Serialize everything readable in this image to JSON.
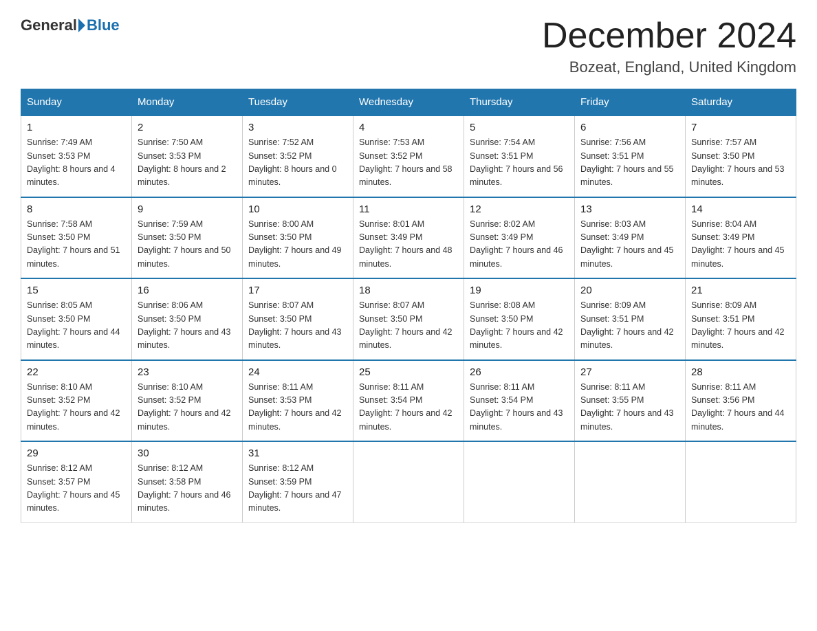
{
  "header": {
    "logo_general": "General",
    "logo_blue": "Blue",
    "month_title": "December 2024",
    "location": "Bozeat, England, United Kingdom"
  },
  "days_of_week": [
    "Sunday",
    "Monday",
    "Tuesday",
    "Wednesday",
    "Thursday",
    "Friday",
    "Saturday"
  ],
  "weeks": [
    [
      {
        "day": "1",
        "sunrise": "7:49 AM",
        "sunset": "3:53 PM",
        "daylight": "8 hours and 4 minutes."
      },
      {
        "day": "2",
        "sunrise": "7:50 AM",
        "sunset": "3:53 PM",
        "daylight": "8 hours and 2 minutes."
      },
      {
        "day": "3",
        "sunrise": "7:52 AM",
        "sunset": "3:52 PM",
        "daylight": "8 hours and 0 minutes."
      },
      {
        "day": "4",
        "sunrise": "7:53 AM",
        "sunset": "3:52 PM",
        "daylight": "7 hours and 58 minutes."
      },
      {
        "day": "5",
        "sunrise": "7:54 AM",
        "sunset": "3:51 PM",
        "daylight": "7 hours and 56 minutes."
      },
      {
        "day": "6",
        "sunrise": "7:56 AM",
        "sunset": "3:51 PM",
        "daylight": "7 hours and 55 minutes."
      },
      {
        "day": "7",
        "sunrise": "7:57 AM",
        "sunset": "3:50 PM",
        "daylight": "7 hours and 53 minutes."
      }
    ],
    [
      {
        "day": "8",
        "sunrise": "7:58 AM",
        "sunset": "3:50 PM",
        "daylight": "7 hours and 51 minutes."
      },
      {
        "day": "9",
        "sunrise": "7:59 AM",
        "sunset": "3:50 PM",
        "daylight": "7 hours and 50 minutes."
      },
      {
        "day": "10",
        "sunrise": "8:00 AM",
        "sunset": "3:50 PM",
        "daylight": "7 hours and 49 minutes."
      },
      {
        "day": "11",
        "sunrise": "8:01 AM",
        "sunset": "3:49 PM",
        "daylight": "7 hours and 48 minutes."
      },
      {
        "day": "12",
        "sunrise": "8:02 AM",
        "sunset": "3:49 PM",
        "daylight": "7 hours and 46 minutes."
      },
      {
        "day": "13",
        "sunrise": "8:03 AM",
        "sunset": "3:49 PM",
        "daylight": "7 hours and 45 minutes."
      },
      {
        "day": "14",
        "sunrise": "8:04 AM",
        "sunset": "3:49 PM",
        "daylight": "7 hours and 45 minutes."
      }
    ],
    [
      {
        "day": "15",
        "sunrise": "8:05 AM",
        "sunset": "3:50 PM",
        "daylight": "7 hours and 44 minutes."
      },
      {
        "day": "16",
        "sunrise": "8:06 AM",
        "sunset": "3:50 PM",
        "daylight": "7 hours and 43 minutes."
      },
      {
        "day": "17",
        "sunrise": "8:07 AM",
        "sunset": "3:50 PM",
        "daylight": "7 hours and 43 minutes."
      },
      {
        "day": "18",
        "sunrise": "8:07 AM",
        "sunset": "3:50 PM",
        "daylight": "7 hours and 42 minutes."
      },
      {
        "day": "19",
        "sunrise": "8:08 AM",
        "sunset": "3:50 PM",
        "daylight": "7 hours and 42 minutes."
      },
      {
        "day": "20",
        "sunrise": "8:09 AM",
        "sunset": "3:51 PM",
        "daylight": "7 hours and 42 minutes."
      },
      {
        "day": "21",
        "sunrise": "8:09 AM",
        "sunset": "3:51 PM",
        "daylight": "7 hours and 42 minutes."
      }
    ],
    [
      {
        "day": "22",
        "sunrise": "8:10 AM",
        "sunset": "3:52 PM",
        "daylight": "7 hours and 42 minutes."
      },
      {
        "day": "23",
        "sunrise": "8:10 AM",
        "sunset": "3:52 PM",
        "daylight": "7 hours and 42 minutes."
      },
      {
        "day": "24",
        "sunrise": "8:11 AM",
        "sunset": "3:53 PM",
        "daylight": "7 hours and 42 minutes."
      },
      {
        "day": "25",
        "sunrise": "8:11 AM",
        "sunset": "3:54 PM",
        "daylight": "7 hours and 42 minutes."
      },
      {
        "day": "26",
        "sunrise": "8:11 AM",
        "sunset": "3:54 PM",
        "daylight": "7 hours and 43 minutes."
      },
      {
        "day": "27",
        "sunrise": "8:11 AM",
        "sunset": "3:55 PM",
        "daylight": "7 hours and 43 minutes."
      },
      {
        "day": "28",
        "sunrise": "8:11 AM",
        "sunset": "3:56 PM",
        "daylight": "7 hours and 44 minutes."
      }
    ],
    [
      {
        "day": "29",
        "sunrise": "8:12 AM",
        "sunset": "3:57 PM",
        "daylight": "7 hours and 45 minutes."
      },
      {
        "day": "30",
        "sunrise": "8:12 AM",
        "sunset": "3:58 PM",
        "daylight": "7 hours and 46 minutes."
      },
      {
        "day": "31",
        "sunrise": "8:12 AM",
        "sunset": "3:59 PM",
        "daylight": "7 hours and 47 minutes."
      },
      null,
      null,
      null,
      null
    ]
  ]
}
